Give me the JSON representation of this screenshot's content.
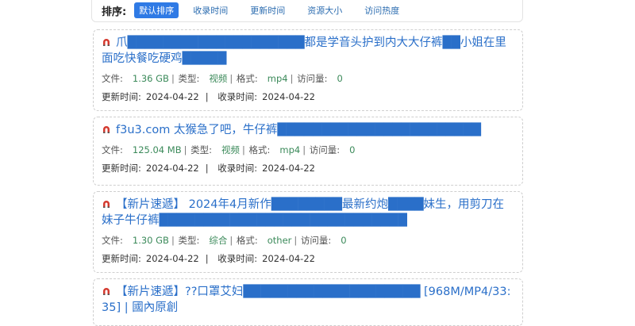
{
  "sort": {
    "label": "排序:",
    "options": [
      "默认排序",
      "收录时间",
      "更新时间",
      "资源大小",
      "访问热度"
    ],
    "active_index": 0
  },
  "labels": {
    "file": "文件:",
    "type": "类型:",
    "format": "格式:",
    "views": "访问量:",
    "updated": "更新时间:",
    "indexed": "收录时间:"
  },
  "colors": {
    "accent": "#2f7ae5",
    "title": "#2a6fc9",
    "value": "#3b8a5a",
    "magnet": "#d43a2f"
  },
  "results": [
    {
      "title": "爪████████████████████都是学音头护到内大大仔裤██小姐在里面吃快餐吃硬鸡█████",
      "size": "1.36 GB",
      "type": "视频",
      "format": "mp4",
      "views": "0",
      "updated": "2024-04-22",
      "indexed": "2024-04-22"
    },
    {
      "title": "f3u3.com 太猴急了吧，牛仔裤███████████████████████",
      "size": "125.04 MB",
      "type": "视频",
      "format": "mp4",
      "views": "0",
      "updated": "2024-04-22",
      "indexed": "2024-04-22"
    },
    {
      "title": "【新片速遞】 2024年4月新作████████最新约炮████妹生，用剪刀在妹子牛仔裤████████████████████████████",
      "size": "1.30 GB",
      "type": "综合",
      "format": "other",
      "views": "0",
      "updated": "2024-04-22",
      "indexed": "2024-04-22"
    },
    {
      "title": "【新片速遞】??口罩艾妇████████████████████ [968M/MP4/33:35] | 國內原創",
      "size": "",
      "type": "",
      "format": "",
      "views": "",
      "updated": "",
      "indexed": ""
    }
  ]
}
